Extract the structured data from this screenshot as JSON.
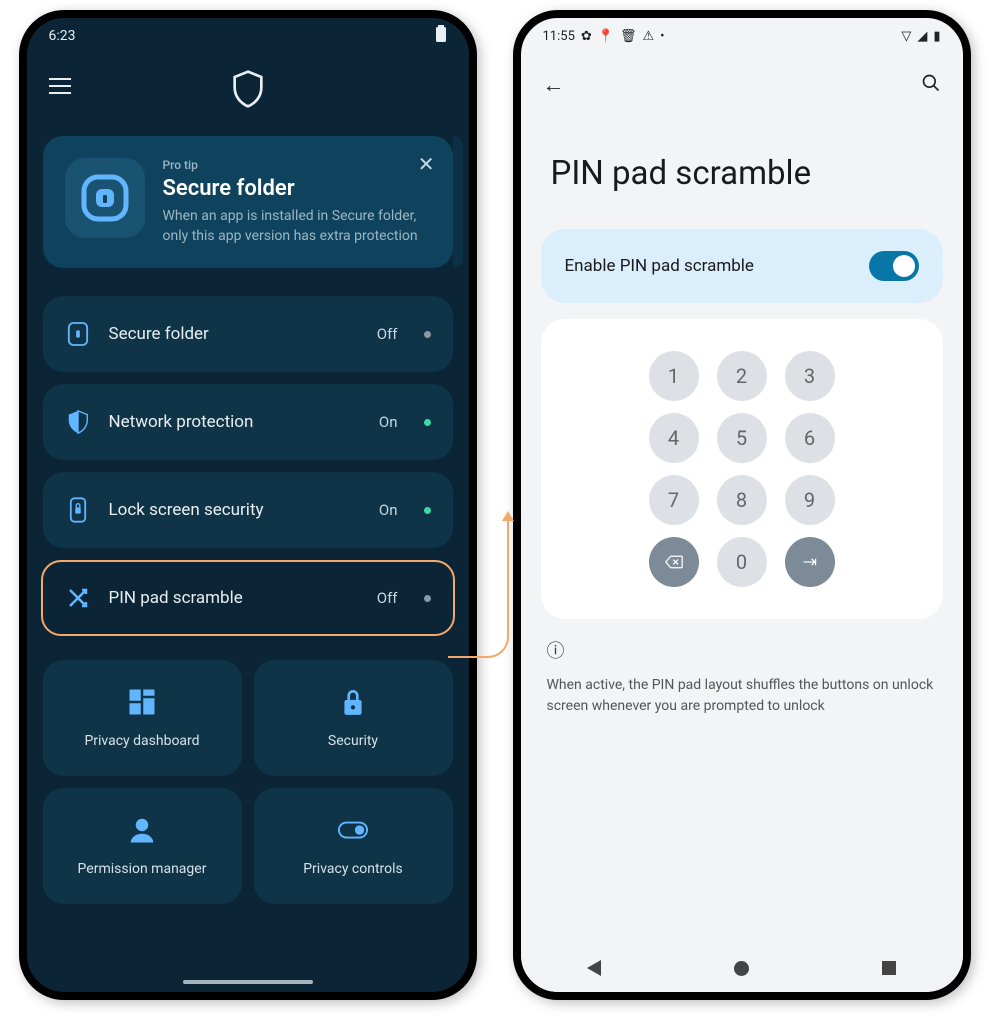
{
  "left": {
    "statusbar": {
      "time": "6:23"
    },
    "protip": {
      "label": "Pro tip",
      "title": "Secure folder",
      "body": "When an app is installed in Secure folder, only this app version has extra protection"
    },
    "rows": [
      {
        "label": "Secure folder",
        "status": "Off",
        "dot": "off"
      },
      {
        "label": "Network protection",
        "status": "On",
        "dot": "on"
      },
      {
        "label": "Lock screen security",
        "status": "On",
        "dot": "on"
      },
      {
        "label": "PIN pad scramble",
        "status": "Off",
        "dot": "off"
      }
    ],
    "tiles": [
      {
        "label": "Privacy dashboard"
      },
      {
        "label": "Security"
      },
      {
        "label": "Permission manager"
      },
      {
        "label": "Privacy controls"
      }
    ]
  },
  "right": {
    "statusbar": {
      "time": "11:55"
    },
    "title": "PIN pad scramble",
    "toggle_label": "Enable PIN pad scramble",
    "keys": [
      "1",
      "2",
      "3",
      "4",
      "5",
      "6",
      "7",
      "8",
      "9",
      "⌫",
      "0",
      "→"
    ],
    "info": "When active, the PIN pad layout shuffles the buttons on unlock screen whenever you are prompted to unlock"
  }
}
